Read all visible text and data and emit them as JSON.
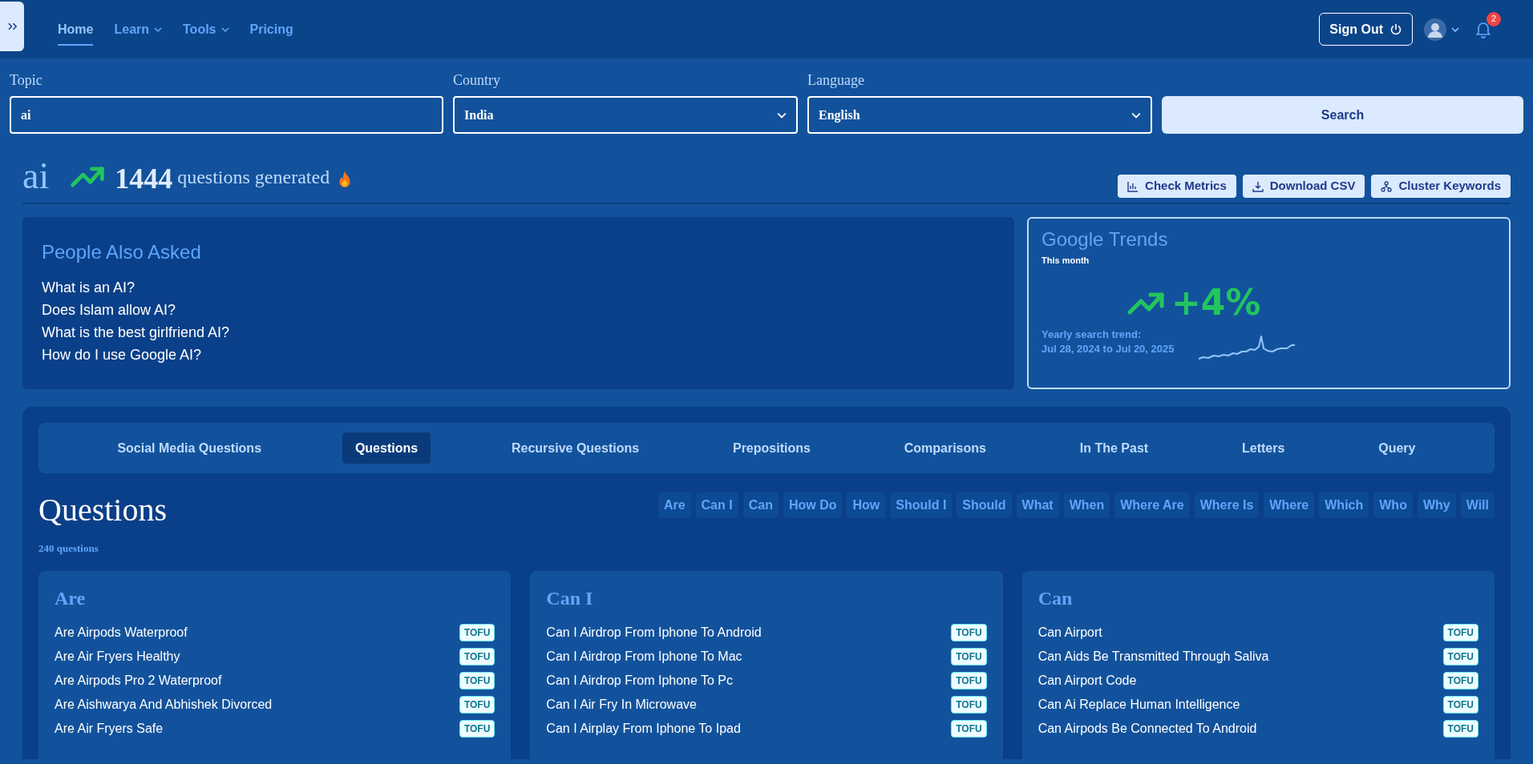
{
  "nav": {
    "items": [
      {
        "label": "Home",
        "selected": true,
        "kind": "link"
      },
      {
        "label": "Learn",
        "selected": false,
        "kind": "dropdown"
      },
      {
        "label": "Tools",
        "selected": false,
        "kind": "dropdown"
      },
      {
        "label": "Pricing",
        "selected": false,
        "kind": "link"
      }
    ],
    "sign_out": "Sign Out",
    "notifications": "2"
  },
  "search": {
    "fields": [
      {
        "label": "Topic",
        "value": "ai",
        "kind": "text"
      },
      {
        "label": "Country",
        "value": "India",
        "kind": "select"
      },
      {
        "label": "Language",
        "value": "English",
        "kind": "select"
      }
    ],
    "button": "Search"
  },
  "summary": {
    "topic": "ai",
    "count": "1444",
    "caption": "questions generated",
    "actions": [
      {
        "label": "Check Metrics",
        "kind": "metrics"
      },
      {
        "label": "Download CSV",
        "kind": "download"
      },
      {
        "label": "Cluster Keywords",
        "kind": "cluster"
      }
    ]
  },
  "people_also_asked": {
    "title": "People Also Asked",
    "questions": [
      "What is an AI?",
      "Does Islam allow AI?",
      "What is the best girlfriend AI?",
      "How do I use Google AI?"
    ]
  },
  "google_trends": {
    "title": "Google Trends",
    "period": "This month",
    "change": "+4%",
    "trend_label": "Yearly search trend:",
    "range": "Jul 28, 2024 to Jul 20, 2025"
  },
  "tabs": [
    {
      "label": "Social Media Questions",
      "selected": false
    },
    {
      "label": "Questions",
      "selected": true
    },
    {
      "label": "Recursive Questions",
      "selected": false
    },
    {
      "label": "Prepositions",
      "selected": false
    },
    {
      "label": "Comparisons",
      "selected": false
    },
    {
      "label": "In The Past",
      "selected": false
    },
    {
      "label": "Letters",
      "selected": false
    },
    {
      "label": "Query",
      "selected": false
    }
  ],
  "section": {
    "title": "Questions",
    "count": "240 questions",
    "filters": [
      "Are",
      "Can I",
      "Can",
      "How Do",
      "How",
      "Should I",
      "Should",
      "What",
      "When",
      "Where Are",
      "Where Is",
      "Where",
      "Which",
      "Who",
      "Why",
      "Will"
    ]
  },
  "groups": [
    {
      "title": "Are",
      "items": [
        {
          "text": "Are Airpods Waterproof",
          "badge": "TOFU"
        },
        {
          "text": "Are Air Fryers Healthy",
          "badge": "TOFU"
        },
        {
          "text": "Are Airpods Pro 2 Waterproof",
          "badge": "TOFU"
        },
        {
          "text": "Are Aishwarya And Abhishek Divorced",
          "badge": "TOFU"
        },
        {
          "text": "Are Air Fryers Safe",
          "badge": "TOFU"
        }
      ]
    },
    {
      "title": "Can I",
      "items": [
        {
          "text": "Can I Airdrop From Iphone To Android",
          "badge": "TOFU"
        },
        {
          "text": "Can I Airdrop From Iphone To Mac",
          "badge": "TOFU"
        },
        {
          "text": "Can I Airdrop From Iphone To Pc",
          "badge": "TOFU"
        },
        {
          "text": "Can I Air Fry In Microwave",
          "badge": "TOFU"
        },
        {
          "text": "Can I Airplay From Iphone To Ipad",
          "badge": "TOFU"
        }
      ]
    },
    {
      "title": "Can",
      "items": [
        {
          "text": "Can Airport",
          "badge": "TOFU"
        },
        {
          "text": "Can Aids Be Transmitted Through Saliva",
          "badge": "TOFU"
        },
        {
          "text": "Can Airport Code",
          "badge": "TOFU"
        },
        {
          "text": "Can Ai Replace Human Intelligence",
          "badge": "TOFU"
        },
        {
          "text": "Can Airpods Be Connected To Android",
          "badge": "TOFU"
        }
      ]
    }
  ]
}
